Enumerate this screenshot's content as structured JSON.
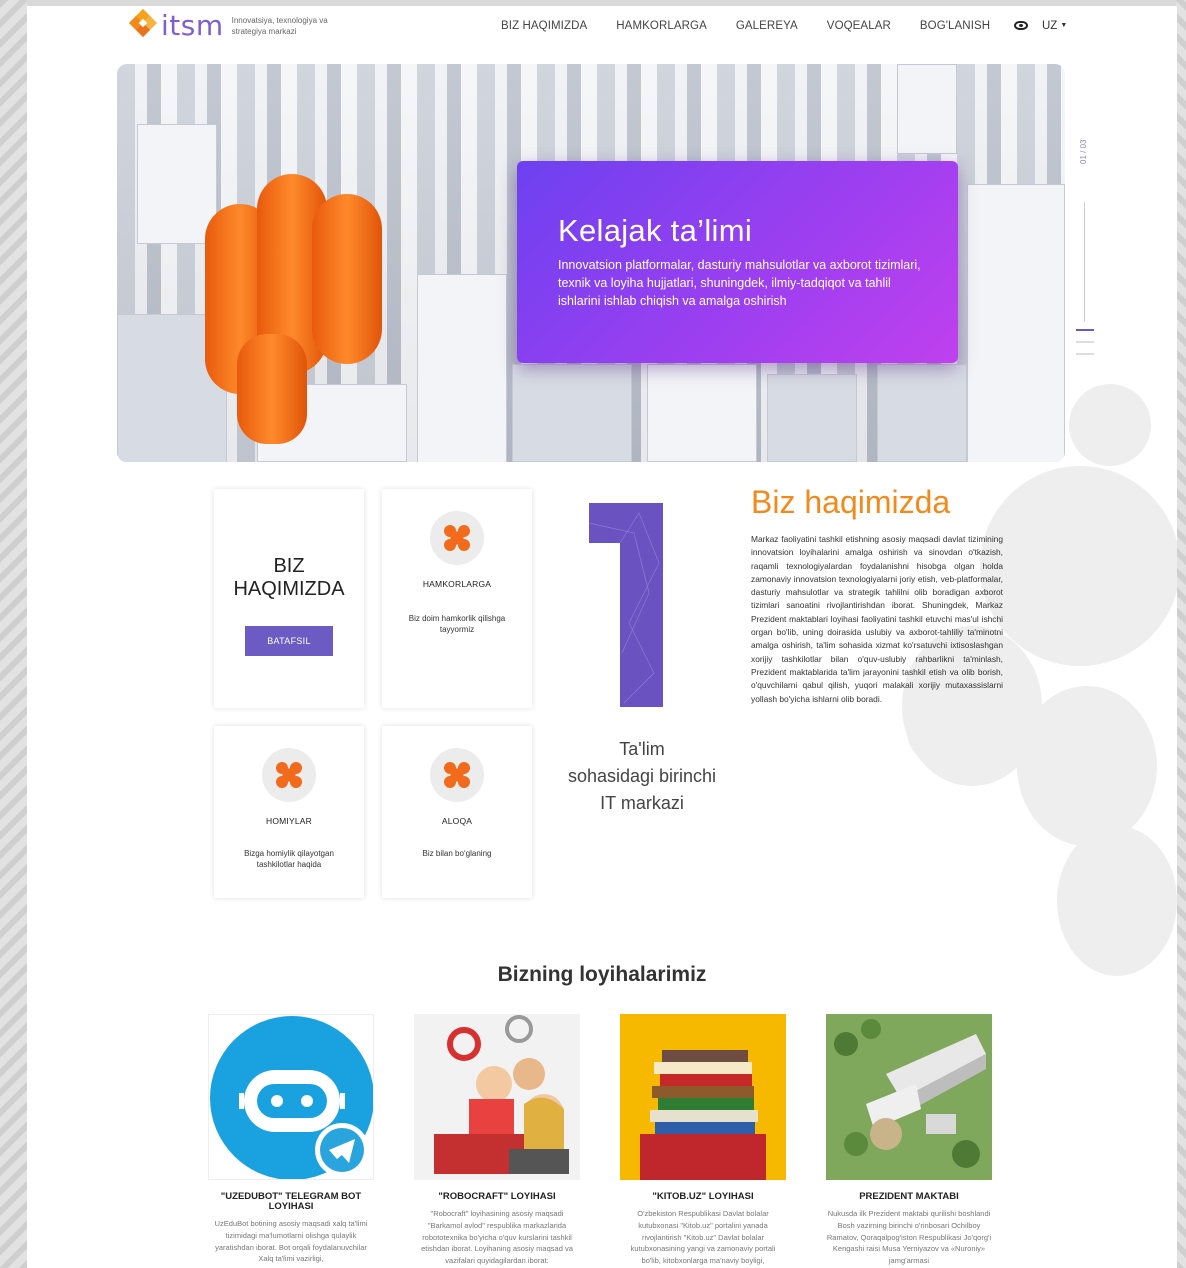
{
  "header": {
    "logo_text": "itsm",
    "logo_subtitle": "Innovatsiya, texnologiya va strategiya markazi",
    "nav": [
      "BIZ HAQIMIZDA",
      "HAMKORLARGA",
      "GALEREYA",
      "VOQEALAR",
      "BOG'LANISH"
    ],
    "language": "UZ"
  },
  "hero": {
    "title": "Kelajak ta’limi",
    "text": "Innovatsion platformalar, dasturiy mahsulotlar va axborot tizimlari, texnik va loyiha hujjatlari, shuningdek, ilmiy-tadqiqot va tahlil ishlarini ishlab chiqish va amalga oshirish",
    "slide_counter": "01 / 03"
  },
  "cards": {
    "about": {
      "title_line1": "BIZ",
      "title_line2": "HAQIMIZDA",
      "button": "BATAFSIL"
    },
    "partners": {
      "title": "HAMKORLARGA",
      "text": "Biz doim hamkorlik qilishga tayyormiz"
    },
    "sponsors": {
      "title": "HOMIYLAR",
      "text": "Bizga homiylik qilayotgan tashkilotlar haqida"
    },
    "contact": {
      "title": "ALOQA",
      "text": "Biz bilan bo‘glaning"
    }
  },
  "first_it": {
    "line1": "Ta'lim",
    "line2": "sohasidagi birinchi",
    "line3": "IT markazi"
  },
  "about": {
    "title": "Biz haqimizda",
    "text": "Markaz faoliyatini tashkil etishning asosiy maqsadi davlat tizimining innovatsion loyihalarini amalga oshirish va sinovdan o'tkazish, raqamli texnologiyalardan foydalanishni hisobga olgan holda zamonaviy innovatsion texnologiyalarni joriy etish, veb-platformalar, dasturiy mahsulotlar va strategik tahlilni olib boradigan axborot tizimlari sanoatini rivojlantirishdan iborat. Shuningdek, Markaz Prezident maktablari loyihasi faoliyatini tashkil etuvchi mas'ul ishchi organ bo'lib, uning doirasida uslubiy va axborot-tahliliy ta'minotni amalga oshirish, ta'lim sohasida xizmat ko'rsatuvchi ixtisoslashgan xorijiy tashkilotlar bilan o'quv-uslubiy rahbarlikni ta'minlash, Prezident maktablarida ta'lim jarayonini tashkil etish va olib borish, o'quvchilarni qabul qilish, yuqori malakali xorijiy mutaxassislarni yollash bo'yicha ishlarni olib boradi."
  },
  "projects": {
    "title": "Bizning loyihalarimiz",
    "items": [
      {
        "title": "\"UZEDUBOT\" TELEGRAM BOT LOYIHASI",
        "text": "UzEduBot botining asosiy maqsadi xalq ta'limi tizimidagi ma'lumotlarni olishga qulaylik yaratishdan iborat. Bot orqali foydalanuvchilar Xalq ta'limi vazirligi,"
      },
      {
        "title": "\"ROBOCRAFT\" LOYIHASI",
        "text": "\"Robocraft\" loyihasining asosiy maqsadi \"Barkamol avlod\" respublika markazlarida robototexnika bo'yicha o'quv kurslarini tashkil etishdan iborat. Loyihaning asosiy maqsad va vazifalari quyidagilardan iborat:"
      },
      {
        "title": "\"KITOB.UZ\" LOYIHASI",
        "text": "O'zbekiston Respublikasi Davlat bolalar kutubxonasi \"Kitob.uz\" portalini yanada rivojlantirish \"Kitob.uz\" Davlat bolalar kutubxonasining yangi va zamonaviy portali bo'lib, kitobxonlarga ma'naviy boyligi,"
      },
      {
        "title": "PREZIDENT MAKTABI",
        "text": "Nukusda ilk Prezident maktabi qurilishi boshlandi Bosh vazirning birinchi o'rinbosari Ochilboy Ramatov, Qoraqalpog'iston Respublikasi Jo'qorg'i Kengashi raisi Musa Yerniyazov va «Nuroniy» jamg'armasi"
      }
    ]
  },
  "colors": {
    "accent_purple": "#6b5bc2",
    "accent_orange": "#f28a1b",
    "hero_gradient_start": "#6d41f0",
    "hero_gradient_end": "#c040ee"
  }
}
